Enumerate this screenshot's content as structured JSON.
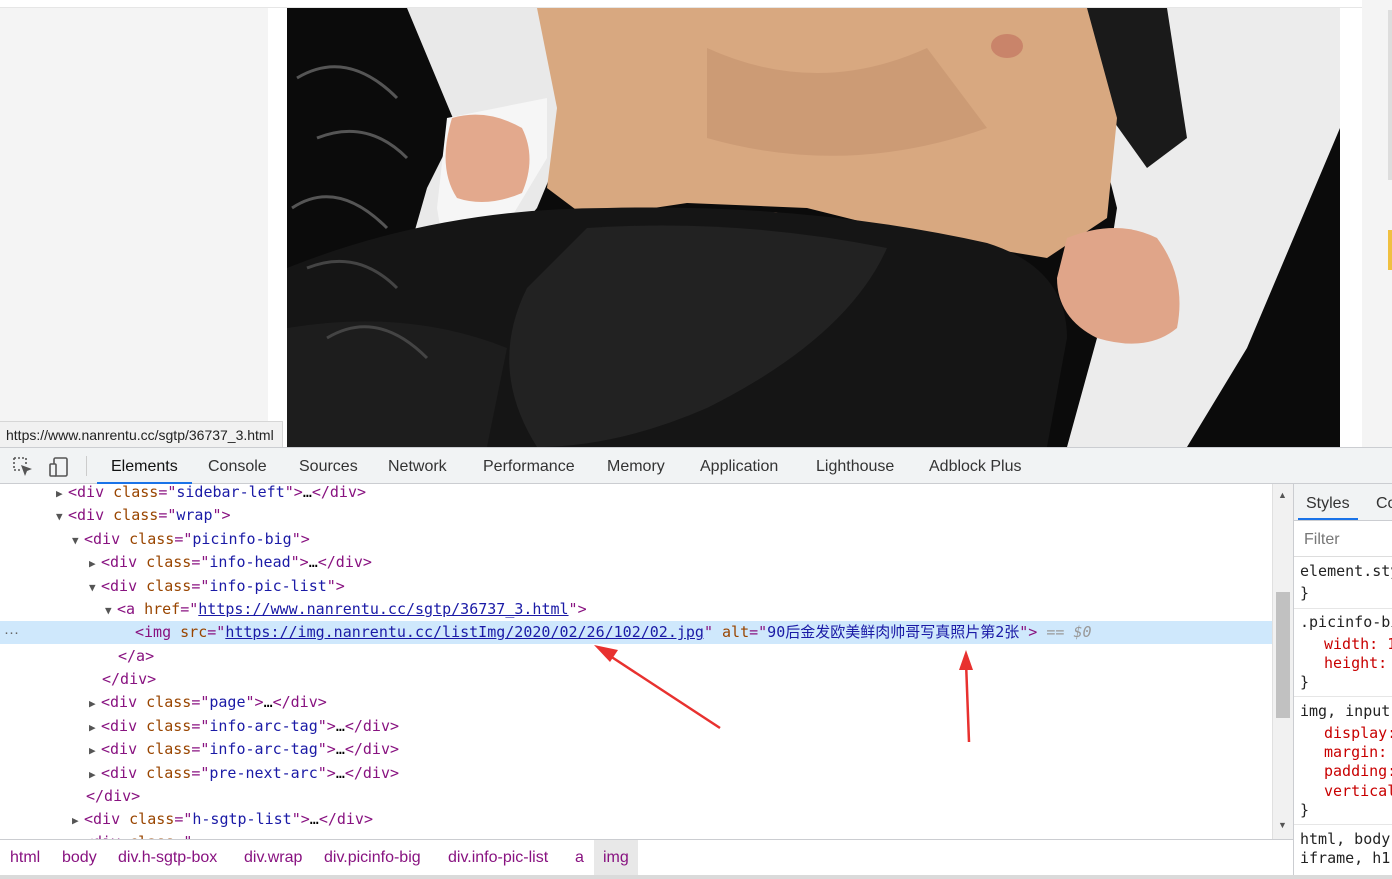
{
  "page": {
    "status_url": "https://www.nanrentu.cc/sgtp/36737_3.html",
    "photo_alt": "90后金发欧美鲜肉帅哥写真照片第2张"
  },
  "devtools": {
    "tabs": [
      "Elements",
      "Console",
      "Sources",
      "Network",
      "Performance",
      "Memory",
      "Application",
      "Lighthouse",
      "Adblock Plus"
    ],
    "active_tab": "Elements",
    "dom": {
      "l1_class": "sidebar-left",
      "l2_class": "wrap",
      "l3_class": "picinfo-big",
      "l4_class": "info-head",
      "l5_class": "info-pic-list",
      "a_href": "https://www.nanrentu.cc/sgtp/36737_3.html",
      "img_src": "https://img.nanrentu.cc/listImg/2020/02/26/102/02.jpg",
      "img_alt": "90后金发欧美鲜肉帅哥写真照片第2张",
      "selected_marker": "== $0",
      "page_class": "page",
      "tag_class": "info-arc-tag",
      "prev_next_class": "pre-next-arc",
      "sgtp_list_class": "h-sgtp-list",
      "ellipsis": "…",
      "dots": "···"
    },
    "breadcrumb": [
      "html",
      "body",
      "div.h-sgtp-box",
      "div.wrap",
      "div.picinfo-big",
      "div.info-pic-list",
      "a",
      "img"
    ],
    "styles_panel": {
      "tabs": [
        "Styles",
        "Co"
      ],
      "filter_placeholder": "Filter",
      "rules": {
        "r1": "element.sty",
        "r1_close": "}",
        "r2": ".picinfo-bi",
        "r2_p1": "width: 1",
        "r2_p2": "height:",
        "r2_close": "}",
        "r3": "img, input",
        "r3_p1": "display:",
        "r3_p2": "margin:",
        "r3_p3": "padding:",
        "r3_p4": "vertical",
        "r3_close": "}",
        "r4": "html, body",
        "r4_b": "iframe, h1"
      }
    },
    "colors": {
      "accent": "#1a73e8",
      "tag": "#881280",
      "attr": "#994500",
      "value": "#1a1aa6",
      "selected_row": "#cfe8fc",
      "annotation_arrow": "#e8312f"
    }
  }
}
